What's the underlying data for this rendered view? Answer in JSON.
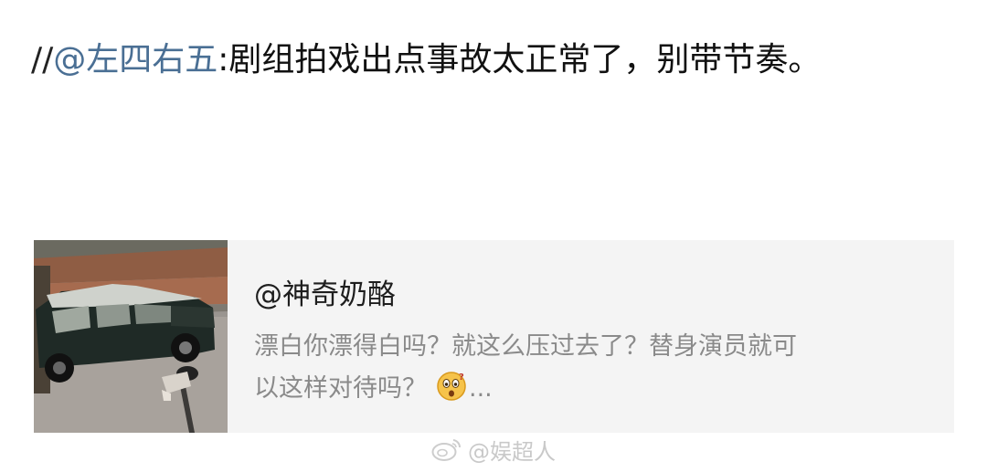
{
  "repost": {
    "prefix": "//",
    "mention": "@左四右五",
    "colon": ":",
    "text": "剧组拍戏出点事故太正常了，别带节奏。"
  },
  "card": {
    "author": "@神奇奶酪",
    "body_line1": "漂白你漂得白吗？就这么压过去了？替身演员就可",
    "body_line2": "以这样对待吗？",
    "ellipsis": "...",
    "emoji_icon": "surprised-face-icon"
  },
  "watermark": {
    "text": "@娱超人",
    "logo_icon": "weibo-logo-icon"
  }
}
